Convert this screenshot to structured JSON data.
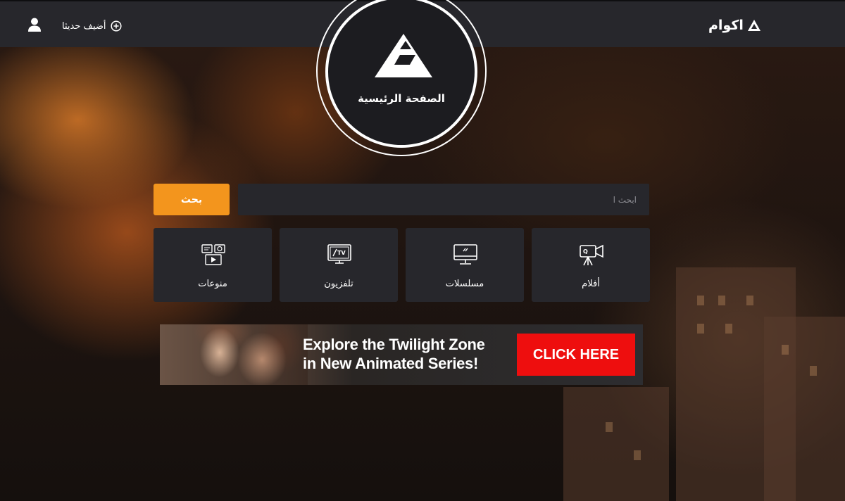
{
  "header": {
    "logo_text": "اكوام",
    "add_new_label": "أضيف حديثا"
  },
  "home": {
    "label": "الصفحة الرئيسية"
  },
  "search": {
    "placeholder": "ابحث ا",
    "button_label": "بحث"
  },
  "categories": [
    {
      "label": "أفلام",
      "icon": "movie-camera-icon"
    },
    {
      "label": "مسلسلات",
      "icon": "monitor-icon"
    },
    {
      "label": "تلفزيون",
      "icon": "tv-icon"
    },
    {
      "label": "منوعات",
      "icon": "media-mix-icon"
    }
  ],
  "ad": {
    "headline_line1": "Explore the Twilight Zone",
    "headline_line2": "in New Animated Series!",
    "cta_label": "CLICK HERE"
  },
  "colors": {
    "topbar": "#27272c",
    "accent": "#f3951d",
    "card": "#27272c",
    "ad_cta": "#ee0e0e"
  }
}
